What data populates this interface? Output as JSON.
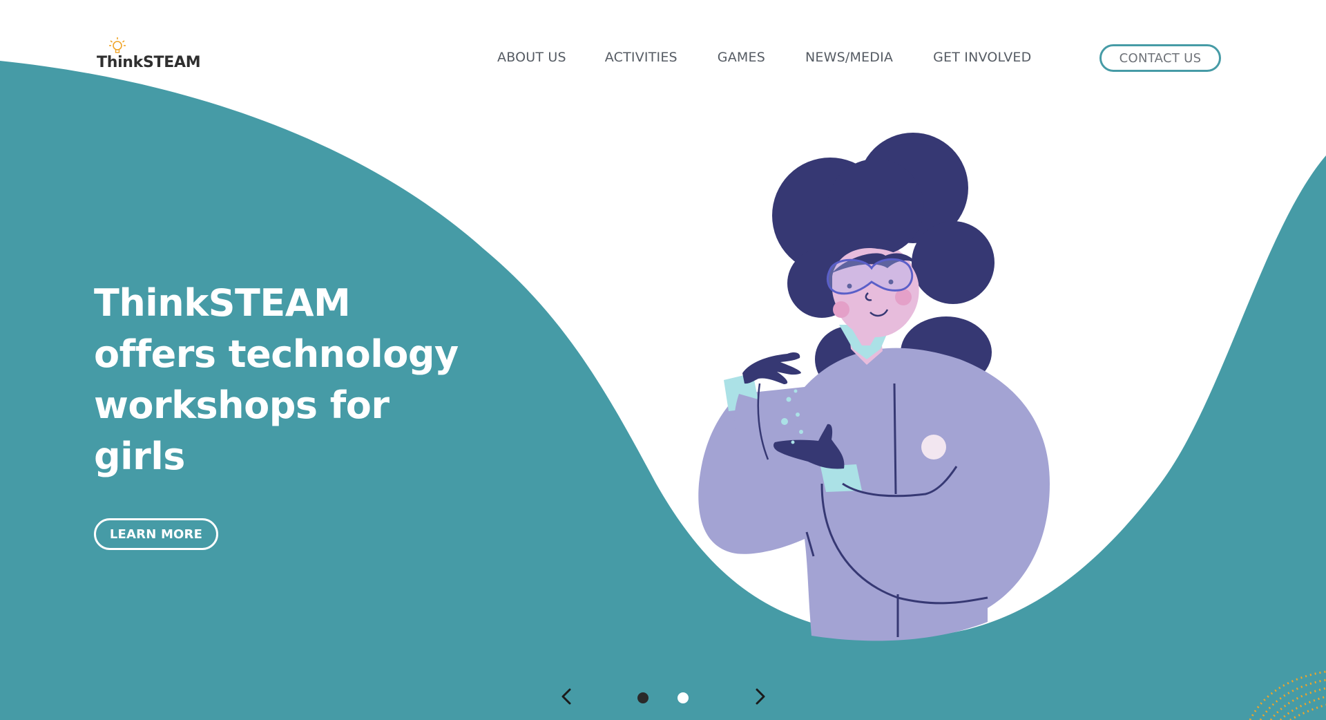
{
  "brand": {
    "name": "ThinkSTEAM",
    "logo_icon": "lightbulb-icon"
  },
  "nav": {
    "items": [
      {
        "label": "ABOUT US"
      },
      {
        "label": "ACTIVITIES"
      },
      {
        "label": "GAMES"
      },
      {
        "label": "NEWS/MEDIA"
      },
      {
        "label": "GET INVOLVED"
      }
    ],
    "contact_label": "CONTACT US"
  },
  "hero": {
    "title": "ThinkSTEAM offers technology workshops for girls",
    "title_lines": [
      "ThinkSTEAM",
      "offers technology",
      "workshops for",
      "girls"
    ],
    "button_label": "LEARN MORE"
  },
  "carousel": {
    "prev_icon": "chevron-left-icon",
    "next_icon": "chevron-right-icon",
    "slides": 2,
    "active_slide": 1
  },
  "colors": {
    "teal": "#469ba6",
    "navy": "#363873",
    "lavender": "#a3a3d3",
    "skin": "#e7bcdc",
    "mint": "#abe1e6",
    "accent_orange": "#f0a528"
  }
}
